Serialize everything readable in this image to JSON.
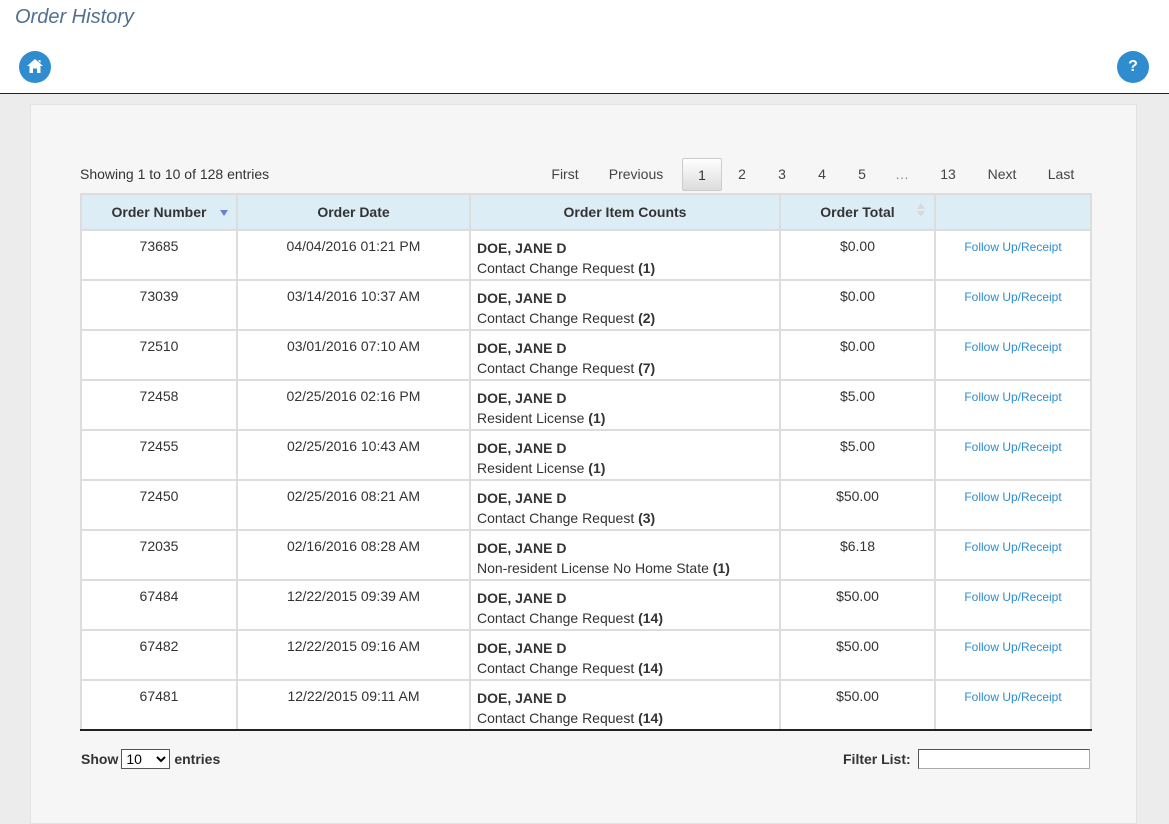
{
  "header": {
    "title": "Order History",
    "home_icon": "home-icon",
    "help_icon": "help-icon",
    "help_glyph": "?"
  },
  "table_info": "Showing 1 to 10 of 128 entries",
  "pagination": {
    "first": "First",
    "previous": "Previous",
    "pages": [
      "1",
      "2",
      "3",
      "4",
      "5"
    ],
    "ellipsis": "…",
    "last_page": "13",
    "next": "Next",
    "last": "Last",
    "current": "1"
  },
  "columns": {
    "order_number": "Order Number",
    "order_date": "Order Date",
    "item_counts": "Order Item Counts",
    "order_total": "Order Total",
    "action": ""
  },
  "rows": [
    {
      "number": "73685",
      "date": "04/04/2016 01:21 PM",
      "name": "DOE, JANE D",
      "item": "Contact Change Request",
      "count": "(1)",
      "total": "$0.00",
      "link": "Follow Up/Receipt"
    },
    {
      "number": "73039",
      "date": "03/14/2016 10:37 AM",
      "name": "DOE, JANE D",
      "item": "Contact Change Request",
      "count": "(2)",
      "total": "$0.00",
      "link": "Follow Up/Receipt"
    },
    {
      "number": "72510",
      "date": "03/01/2016 07:10 AM",
      "name": "DOE, JANE D",
      "item": "Contact Change Request",
      "count": "(7)",
      "total": "$0.00",
      "link": "Follow Up/Receipt"
    },
    {
      "number": "72458",
      "date": "02/25/2016 02:16 PM",
      "name": "DOE, JANE D",
      "item": "Resident License",
      "count": "(1)",
      "total": "$5.00",
      "link": "Follow Up/Receipt"
    },
    {
      "number": "72455",
      "date": "02/25/2016 10:43 AM",
      "name": "DOE, JANE D",
      "item": "Resident License",
      "count": "(1)",
      "total": "$5.00",
      "link": "Follow Up/Receipt"
    },
    {
      "number": "72450",
      "date": "02/25/2016 08:21 AM",
      "name": "DOE, JANE D",
      "item": "Contact Change Request",
      "count": "(3)",
      "total": "$50.00",
      "link": "Follow Up/Receipt"
    },
    {
      "number": "72035",
      "date": "02/16/2016 08:28 AM",
      "name": "DOE, JANE D",
      "item": "Non-resident License No Home State",
      "count": "(1)",
      "total": "$6.18",
      "link": "Follow Up/Receipt"
    },
    {
      "number": "67484",
      "date": "12/22/2015 09:39 AM",
      "name": "DOE, JANE D",
      "item": "Contact Change Request",
      "count": "(14)",
      "total": "$50.00",
      "link": "Follow Up/Receipt"
    },
    {
      "number": "67482",
      "date": "12/22/2015 09:16 AM",
      "name": "DOE, JANE D",
      "item": "Contact Change Request",
      "count": "(14)",
      "total": "$50.00",
      "link": "Follow Up/Receipt"
    },
    {
      "number": "67481",
      "date": "12/22/2015 09:11 AM",
      "name": "DOE, JANE D",
      "item": "Contact Change Request",
      "count": "(14)",
      "total": "$50.00",
      "link": "Follow Up/Receipt"
    }
  ],
  "length_menu": {
    "show_label": "Show",
    "selected": "10",
    "entries_label": "entries"
  },
  "filter": {
    "label": "Filter List:",
    "value": ""
  },
  "colors": {
    "accent": "#2e8ccf",
    "title": "#51708f",
    "header_bg": "#ddedf6"
  }
}
